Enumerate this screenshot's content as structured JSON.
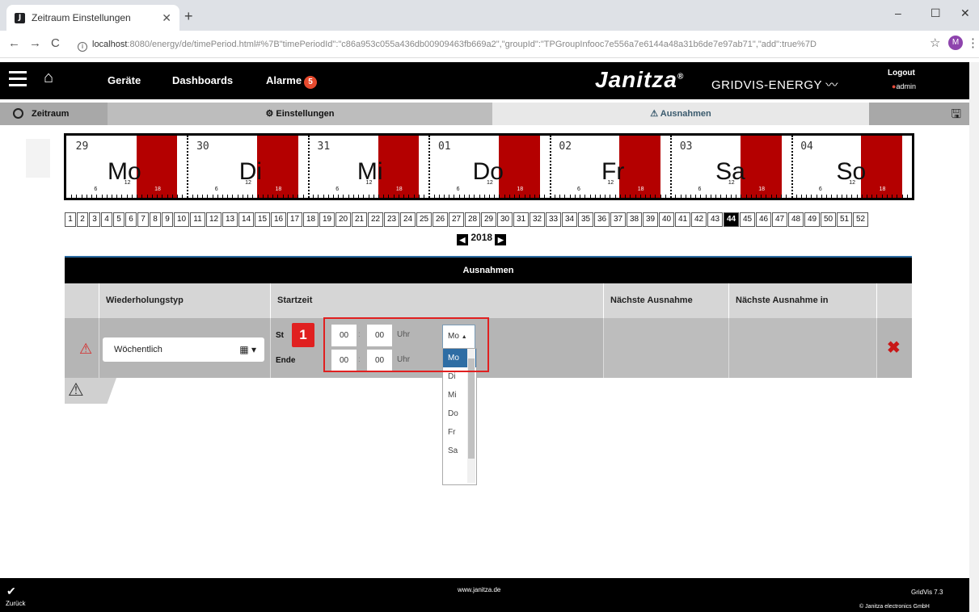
{
  "browser": {
    "tab_title": "Zeitraum Einstellungen",
    "favicon": "J",
    "url_host": "localhost",
    "url_rest": ":8080/energy/de/timePeriod.html#%7B\"timePeriodId\":\"c86a953c055a436db00909463fb669a2\",\"groupId\":\"TPGroupInfooc7e556a7e6144a48a31b6de7e97ab71\",\"add\":true%7D",
    "profile": "M"
  },
  "header": {
    "nav": [
      "Geräte",
      "Dashboards",
      "Alarme"
    ],
    "alarm_count": "5",
    "brand": "Janitza",
    "brand_reg": "®",
    "product": "GRIDVIS-ENERGY",
    "logout": "Logout",
    "user": "admin"
  },
  "subheader": {
    "zeitraum": "Zeitraum",
    "einstellungen": "Einstellungen",
    "ausnahmen": "Ausnahmen"
  },
  "calendar": {
    "days": [
      {
        "num": "29",
        "name": "Mo"
      },
      {
        "num": "30",
        "name": "Di"
      },
      {
        "num": "31",
        "name": "Mi"
      },
      {
        "num": "01",
        "name": "Do"
      },
      {
        "num": "02",
        "name": "Fr"
      },
      {
        "num": "03",
        "name": "Sa"
      },
      {
        "num": "04",
        "name": "So"
      }
    ],
    "hour_labels": [
      "6",
      "12",
      "18"
    ],
    "weeks": [
      "1",
      "2",
      "3",
      "4",
      "5",
      "6",
      "7",
      "8",
      "9",
      "10",
      "11",
      "12",
      "13",
      "14",
      "15",
      "16",
      "17",
      "18",
      "19",
      "20",
      "21",
      "22",
      "23",
      "24",
      "25",
      "26",
      "27",
      "28",
      "29",
      "30",
      "31",
      "32",
      "33",
      "34",
      "35",
      "36",
      "37",
      "38",
      "39",
      "40",
      "41",
      "42",
      "43",
      "44",
      "45",
      "46",
      "47",
      "48",
      "49",
      "50",
      "51",
      "52"
    ],
    "selected_week": "44",
    "year": "2018"
  },
  "panel": {
    "title": "Ausnahmen",
    "columns": [
      "Wiederholungstyp",
      "Startzeit",
      "Nächste Ausnahme",
      "Nächste Ausnahme in"
    ],
    "row": {
      "type": "Wöchentlich",
      "start_label": "St",
      "end_label": "Ende",
      "start_hour": "00",
      "start_min": "00",
      "end_hour": "00",
      "end_min": "00",
      "uhr": "Uhr",
      "day_value": "Mo"
    },
    "day_options": [
      "Mo",
      "Di",
      "Mi",
      "Do",
      "Fr",
      "Sa"
    ],
    "marker": "1"
  },
  "footer": {
    "back": "Zurück",
    "website": "www.janitza.de",
    "version": "GridVis 7.3",
    "copyright": "© Janitza electronics GmbH"
  }
}
